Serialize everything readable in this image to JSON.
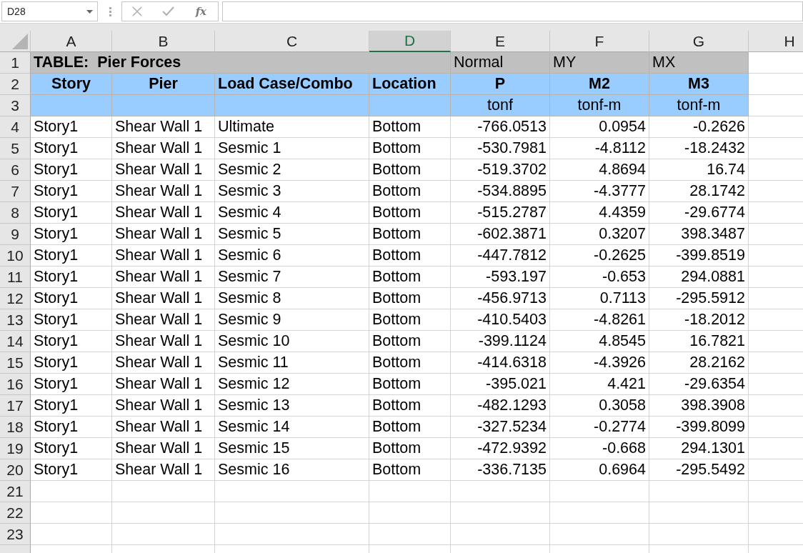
{
  "formula_bar": {
    "name_box": "D28",
    "function_label": "fx"
  },
  "columns": [
    {
      "label": "A",
      "selected": false
    },
    {
      "label": "B",
      "selected": false
    },
    {
      "label": "C",
      "selected": false
    },
    {
      "label": "D",
      "selected": true
    },
    {
      "label": "E",
      "selected": false
    },
    {
      "label": "F",
      "selected": false
    },
    {
      "label": "G",
      "selected": false
    },
    {
      "label": "H",
      "selected": false
    }
  ],
  "rows": [
    {
      "number": "1",
      "kind": "title",
      "title": "TABLE:  Pier Forces",
      "e": "Normal",
      "f": "MY",
      "g": "MX"
    },
    {
      "number": "2",
      "kind": "header",
      "a": "Story",
      "b": "Pier",
      "c": "Load Case/Combo",
      "d": "Location",
      "e": "P",
      "f": "M2",
      "g": "M3"
    },
    {
      "number": "3",
      "kind": "units",
      "e": "tonf",
      "f": "tonf-m",
      "g": "tonf-m"
    },
    {
      "number": "4",
      "kind": "data",
      "a": "Story1",
      "b": "Shear Wall 1",
      "c": "Ultimate",
      "d": "Bottom",
      "e": "-766.0513",
      "f": "0.0954",
      "g": "-0.2626"
    },
    {
      "number": "5",
      "kind": "data",
      "a": "Story1",
      "b": "Shear Wall 1",
      "c": "Sesmic 1",
      "d": "Bottom",
      "e": "-530.7981",
      "f": "-4.8112",
      "g": "-18.2432"
    },
    {
      "number": "6",
      "kind": "data",
      "a": "Story1",
      "b": "Shear Wall 1",
      "c": "Sesmic 2",
      "d": "Bottom",
      "e": "-519.3702",
      "f": "4.8694",
      "g": "16.74"
    },
    {
      "number": "7",
      "kind": "data",
      "a": "Story1",
      "b": "Shear Wall 1",
      "c": "Sesmic 3",
      "d": "Bottom",
      "e": "-534.8895",
      "f": "-4.3777",
      "g": "28.1742"
    },
    {
      "number": "8",
      "kind": "data",
      "a": "Story1",
      "b": "Shear Wall 1",
      "c": "Sesmic 4",
      "d": "Bottom",
      "e": "-515.2787",
      "f": "4.4359",
      "g": "-29.6774"
    },
    {
      "number": "9",
      "kind": "data",
      "a": "Story1",
      "b": "Shear Wall 1",
      "c": "Sesmic 5",
      "d": "Bottom",
      "e": "-602.3871",
      "f": "0.3207",
      "g": "398.3487"
    },
    {
      "number": "10",
      "kind": "data",
      "a": "Story1",
      "b": "Shear Wall 1",
      "c": "Sesmic 6",
      "d": "Bottom",
      "e": "-447.7812",
      "f": "-0.2625",
      "g": "-399.8519"
    },
    {
      "number": "11",
      "kind": "data",
      "a": "Story1",
      "b": "Shear Wall 1",
      "c": "Sesmic 7",
      "d": "Bottom",
      "e": "-593.197",
      "f": "-0.653",
      "g": "294.0881"
    },
    {
      "number": "12",
      "kind": "data",
      "a": "Story1",
      "b": "Shear Wall 1",
      "c": "Sesmic 8",
      "d": "Bottom",
      "e": "-456.9713",
      "f": "0.7113",
      "g": "-295.5912"
    },
    {
      "number": "13",
      "kind": "data",
      "a": "Story1",
      "b": "Shear Wall 1",
      "c": "Sesmic 9",
      "d": "Bottom",
      "e": "-410.5403",
      "f": "-4.8261",
      "g": "-18.2012"
    },
    {
      "number": "14",
      "kind": "data",
      "a": "Story1",
      "b": "Shear Wall 1",
      "c": "Sesmic 10",
      "d": "Bottom",
      "e": "-399.1124",
      "f": "4.8545",
      "g": "16.7821"
    },
    {
      "number": "15",
      "kind": "data",
      "a": "Story1",
      "b": "Shear Wall 1",
      "c": "Sesmic 11",
      "d": "Bottom",
      "e": "-414.6318",
      "f": "-4.3926",
      "g": "28.2162"
    },
    {
      "number": "16",
      "kind": "data",
      "a": "Story1",
      "b": "Shear Wall 1",
      "c": "Sesmic 12",
      "d": "Bottom",
      "e": "-395.021",
      "f": "4.421",
      "g": "-29.6354"
    },
    {
      "number": "17",
      "kind": "data",
      "a": "Story1",
      "b": "Shear Wall 1",
      "c": "Sesmic 13",
      "d": "Bottom",
      "e": "-482.1293",
      "f": "0.3058",
      "g": "398.3908"
    },
    {
      "number": "18",
      "kind": "data",
      "a": "Story1",
      "b": "Shear Wall 1",
      "c": "Sesmic 14",
      "d": "Bottom",
      "e": "-327.5234",
      "f": "-0.2774",
      "g": "-399.8099"
    },
    {
      "number": "19",
      "kind": "data",
      "a": "Story1",
      "b": "Shear Wall 1",
      "c": "Sesmic 15",
      "d": "Bottom",
      "e": "-472.9392",
      "f": "-0.668",
      "g": "294.1301"
    },
    {
      "number": "20",
      "kind": "data",
      "a": "Story1",
      "b": "Shear Wall 1",
      "c": "Sesmic 16",
      "d": "Bottom",
      "e": "-336.7135",
      "f": "0.6964",
      "g": "-295.5492"
    },
    {
      "number": "21",
      "kind": "empty"
    },
    {
      "number": "22",
      "kind": "empty"
    },
    {
      "number": "23",
      "kind": "empty"
    }
  ]
}
